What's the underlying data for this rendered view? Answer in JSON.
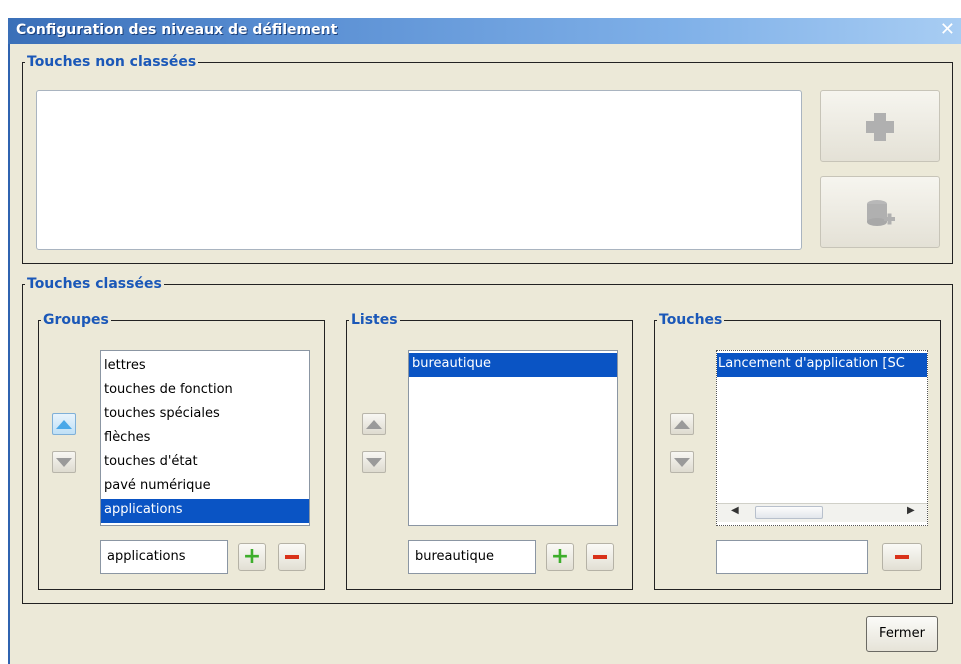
{
  "window": {
    "title": "Configuration des niveaux de défilement",
    "close_icon": "close-icon"
  },
  "unclassified": {
    "legend": "Touches non classées",
    "add_icon": "plus-icon",
    "add_group_icon": "stack-plus-icon"
  },
  "classified": {
    "legend": "Touches classées",
    "groups": {
      "legend": "Groupes",
      "items": [
        "lettres",
        "touches de fonction",
        "touches spéciales",
        "flèches",
        "touches d'état",
        "pavé numérique",
        "applications"
      ],
      "selected": "applications",
      "input_value": "applications"
    },
    "lists": {
      "legend": "Listes",
      "items": [
        "bureautique"
      ],
      "selected": "bureautique",
      "input_value": "bureautique"
    },
    "keys": {
      "legend": "Touches",
      "items": [
        "Lancement d'application [SC"
      ],
      "selected": "Lancement d'application [SC",
      "input_value": ""
    }
  },
  "footer": {
    "close_label": "Fermer"
  },
  "colors": {
    "legend": "#1b58b8",
    "selection": "#0a54c4",
    "titlebar": "#3a6fb8"
  }
}
